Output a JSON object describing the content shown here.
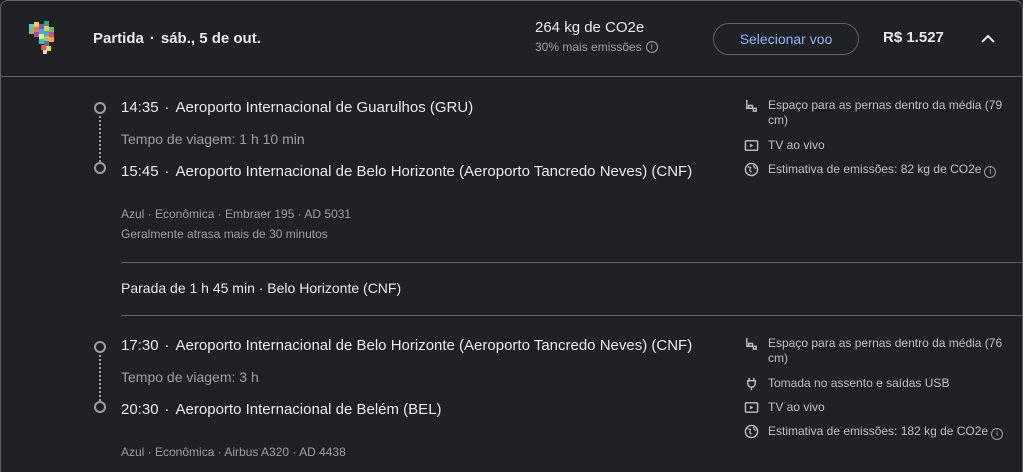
{
  "header": {
    "departure_label": "Partida",
    "departure_date": "sáb., 5 de out.",
    "emissions_total": "264 kg de CO2e",
    "emissions_note": "30% mais emissões",
    "select_button": "Selecionar voo",
    "price": "R$ 1.527"
  },
  "segments": [
    {
      "depart_time": "14:35",
      "depart_airport": "Aeroporto Internacional de Guarulhos (GRU)",
      "travel_time": "Tempo de viagem: 1 h 10 min",
      "arrive_time": "15:45",
      "arrive_airport": "Aeroporto Internacional de Belo Horizonte (Aeroporto Tancredo Neves) (CNF)",
      "details": "Azul · Econômica · Embraer 195 · AD 5031",
      "delay_note": "Geralmente atrasa mais de 30 minutos",
      "amenities": [
        {
          "icon": "legroom-icon",
          "text": "Espaço para as pernas dentro da média (79 cm)"
        },
        {
          "icon": "tv-icon",
          "text": "TV ao vivo"
        },
        {
          "icon": "globe-icon",
          "text": "Estimativa de emissões: 82 kg de CO2e"
        }
      ]
    },
    {
      "depart_time": "17:30",
      "depart_airport": "Aeroporto Internacional de Belo Horizonte (Aeroporto Tancredo Neves) (CNF)",
      "travel_time": "Tempo de viagem: 3 h",
      "arrive_time": "20:30",
      "arrive_airport": "Aeroporto Internacional de Belém (BEL)",
      "details": "Azul · Econômica · Airbus A320 · AD 4438",
      "amenities": [
        {
          "icon": "legroom-icon",
          "text": "Espaço para as pernas dentro da média (76 cm)"
        },
        {
          "icon": "power-plug-icon",
          "text": "Tomada no assento e saídas USB"
        },
        {
          "icon": "tv-icon",
          "text": "TV ao vivo"
        },
        {
          "icon": "globe-icon",
          "text": "Estimativa de emissões: 182 kg de CO2e"
        }
      ]
    }
  ],
  "layover": "Parada de 1 h 45 min · Belo Horizonte (CNF)",
  "separator": "·",
  "colors": {
    "background": "#202124",
    "accent": "#8ab4f8",
    "secondary_text": "#9aa0a6",
    "border": "#5f6368"
  }
}
